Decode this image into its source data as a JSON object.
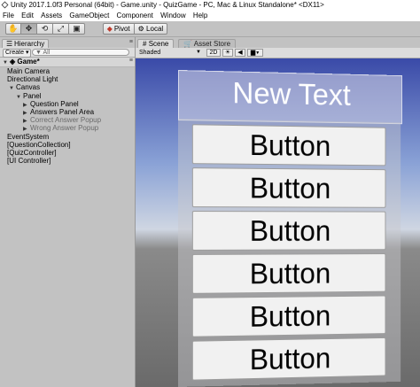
{
  "window": {
    "title": "Unity 2017.1.0f3 Personal (64bit) - Game.unity - QuizGame - PC, Mac & Linux Standalone* <DX11>"
  },
  "menu": [
    "File",
    "Edit",
    "Assets",
    "GameObject",
    "Component",
    "Window",
    "Help"
  ],
  "toolbar": {
    "tools": [
      {
        "icon": "hand-icon",
        "glyph": "✋"
      },
      {
        "icon": "move-icon",
        "glyph": "✥"
      },
      {
        "icon": "rotate-icon",
        "glyph": "⟲"
      },
      {
        "icon": "scale-icon",
        "glyph": "⤢"
      },
      {
        "icon": "rect-icon",
        "glyph": "▣"
      }
    ],
    "pivot_label": "Pivot",
    "local_label": "Local"
  },
  "hierarchy": {
    "tab_label": "Hierarchy",
    "create_label": "Create",
    "search_placeholder": "▼ All",
    "scene_name": "Game*",
    "items": [
      {
        "label": "Main Camera",
        "indent": 0,
        "arrow": "",
        "grey": false
      },
      {
        "label": "Directional Light",
        "indent": 0,
        "arrow": "",
        "grey": false
      },
      {
        "label": "Canvas",
        "indent": 0,
        "arrow": "▼",
        "grey": false
      },
      {
        "label": "Panel",
        "indent": 1,
        "arrow": "▼",
        "grey": false
      },
      {
        "label": "Question Panel",
        "indent": 2,
        "arrow": "▶",
        "grey": false
      },
      {
        "label": "Answers Panel Area",
        "indent": 2,
        "arrow": "▶",
        "grey": false
      },
      {
        "label": "Correct Answer Popup",
        "indent": 2,
        "arrow": "▶",
        "grey": true
      },
      {
        "label": "Wrong Answer Popup",
        "indent": 2,
        "arrow": "▶",
        "grey": true
      },
      {
        "label": "EventSystem",
        "indent": 0,
        "arrow": "",
        "grey": false
      },
      {
        "label": "[QuestionCollection]",
        "indent": 0,
        "arrow": "",
        "grey": false
      },
      {
        "label": "[QuizController]",
        "indent": 0,
        "arrow": "",
        "grey": false
      },
      {
        "label": "[UI Controller]",
        "indent": 0,
        "arrow": "",
        "grey": false
      }
    ]
  },
  "scene": {
    "tab_scene": "Scene",
    "tab_asset_store": "Asset Store",
    "shading_mode": "Shaded",
    "mode_2d": "2D",
    "question_text": "New Text",
    "answer_buttons": [
      "Button",
      "Button",
      "Button",
      "Button",
      "Button",
      "Button"
    ]
  },
  "colors": {
    "sky_top": "#3a4aa8",
    "button_face": "#f1f1f1",
    "editor_grey": "#c2c2c2"
  }
}
